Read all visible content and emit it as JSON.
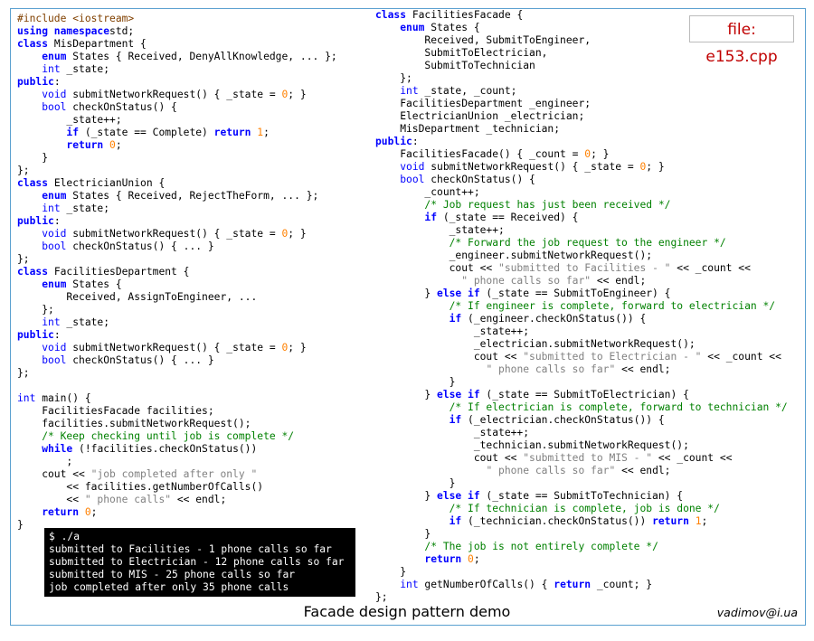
{
  "file_label": "file: e153.cpp",
  "caption": "Facade design pattern demo",
  "author": "vadimov@i.ua",
  "left_code": [
    [
      [
        "pp",
        "#include <iostream>"
      ]
    ],
    [
      [
        "kw",
        "using namespace"
      ],
      [
        "",
        "std;"
      ]
    ],
    [
      [
        "kw",
        "class"
      ],
      [
        "",
        " MisDepartment {"
      ]
    ],
    [
      [
        "",
        "    "
      ],
      [
        "kw",
        "enum"
      ],
      [
        "",
        " States { Received, DenyAllKnowledge, ... };"
      ]
    ],
    [
      [
        "",
        "    "
      ],
      [
        "kt",
        "int"
      ],
      [
        "",
        " _state;"
      ]
    ],
    [
      [
        "kw",
        "public"
      ],
      [
        "",
        ":"
      ]
    ],
    [
      [
        "",
        "    "
      ],
      [
        "kt",
        "void"
      ],
      [
        "",
        " submitNetworkRequest() { _state = "
      ],
      [
        "num",
        "0"
      ],
      [
        "",
        "; }"
      ]
    ],
    [
      [
        "",
        "    "
      ],
      [
        "kt",
        "bool"
      ],
      [
        "",
        " checkOnStatus() {"
      ]
    ],
    [
      [
        "",
        "        _state++;"
      ]
    ],
    [
      [
        "",
        "        "
      ],
      [
        "kw",
        "if"
      ],
      [
        "",
        " (_state == Complete) "
      ],
      [
        "kw",
        "return"
      ],
      [
        "",
        " "
      ],
      [
        "num",
        "1"
      ],
      [
        "",
        ";"
      ]
    ],
    [
      [
        "",
        "        "
      ],
      [
        "kw",
        "return"
      ],
      [
        "",
        " "
      ],
      [
        "num",
        "0"
      ],
      [
        "",
        ";"
      ]
    ],
    [
      [
        "",
        "    }"
      ]
    ],
    [
      [
        "",
        "};"
      ]
    ],
    [
      [
        "kw",
        "class"
      ],
      [
        "",
        " ElectricianUnion {"
      ]
    ],
    [
      [
        "",
        "    "
      ],
      [
        "kw",
        "enum"
      ],
      [
        "",
        " States { Received, RejectTheForm, ... };"
      ]
    ],
    [
      [
        "",
        "    "
      ],
      [
        "kt",
        "int"
      ],
      [
        "",
        " _state;"
      ]
    ],
    [
      [
        "kw",
        "public"
      ],
      [
        "",
        ":"
      ]
    ],
    [
      [
        "",
        "    "
      ],
      [
        "kt",
        "void"
      ],
      [
        "",
        " submitNetworkRequest() { _state = "
      ],
      [
        "num",
        "0"
      ],
      [
        "",
        "; }"
      ]
    ],
    [
      [
        "",
        "    "
      ],
      [
        "kt",
        "bool"
      ],
      [
        "",
        " checkOnStatus() { ... }"
      ]
    ],
    [
      [
        "",
        "};"
      ]
    ],
    [
      [
        "kw",
        "class"
      ],
      [
        "",
        " FacilitiesDepartment {"
      ]
    ],
    [
      [
        "",
        "    "
      ],
      [
        "kw",
        "enum"
      ],
      [
        "",
        " States {"
      ]
    ],
    [
      [
        "",
        "        Received, AssignToEngineer, ..."
      ]
    ],
    [
      [
        "",
        "    };"
      ]
    ],
    [
      [
        "",
        "    "
      ],
      [
        "kt",
        "int"
      ],
      [
        "",
        " _state;"
      ]
    ],
    [
      [
        "kw",
        "public"
      ],
      [
        "",
        ":"
      ]
    ],
    [
      [
        "",
        "    "
      ],
      [
        "kt",
        "void"
      ],
      [
        "",
        " submitNetworkRequest() { _state = "
      ],
      [
        "num",
        "0"
      ],
      [
        "",
        "; }"
      ]
    ],
    [
      [
        "",
        "    "
      ],
      [
        "kt",
        "bool"
      ],
      [
        "",
        " checkOnStatus() { ... }"
      ]
    ],
    [
      [
        "",
        "};"
      ]
    ],
    [
      [
        "",
        ""
      ]
    ],
    [
      [
        "kt",
        "int"
      ],
      [
        "",
        " main() {"
      ]
    ],
    [
      [
        "",
        "    FacilitiesFacade facilities;"
      ]
    ],
    [
      [
        "",
        "    facilities.submitNetworkRequest();"
      ]
    ],
    [
      [
        "",
        "    "
      ],
      [
        "cm",
        "/* Keep checking until job is complete */"
      ]
    ],
    [
      [
        "",
        "    "
      ],
      [
        "kw",
        "while"
      ],
      [
        "",
        " (!facilities.checkOnStatus())"
      ]
    ],
    [
      [
        "",
        "        ;"
      ]
    ],
    [
      [
        "",
        "    cout << "
      ],
      [
        "str",
        "\"job completed after only \""
      ]
    ],
    [
      [
        "",
        "        << facilities.getNumberOfCalls()"
      ]
    ],
    [
      [
        "",
        "        << "
      ],
      [
        "str",
        "\" phone calls\""
      ],
      [
        "",
        " << endl;"
      ]
    ],
    [
      [
        "",
        "    "
      ],
      [
        "kw",
        "return"
      ],
      [
        "",
        " "
      ],
      [
        "num",
        "0"
      ],
      [
        "",
        ";"
      ]
    ],
    [
      [
        "",
        "}"
      ]
    ]
  ],
  "right_code": [
    [
      [
        "kw",
        "class"
      ],
      [
        "",
        " FacilitiesFacade {"
      ]
    ],
    [
      [
        "",
        "    "
      ],
      [
        "kw",
        "enum"
      ],
      [
        "",
        " States {"
      ]
    ],
    [
      [
        "",
        "        Received, SubmitToEngineer,"
      ]
    ],
    [
      [
        "",
        "        SubmitToElectrician,"
      ]
    ],
    [
      [
        "",
        "        SubmitToTechnician"
      ]
    ],
    [
      [
        "",
        "    };"
      ]
    ],
    [
      [
        "",
        "    "
      ],
      [
        "kt",
        "int"
      ],
      [
        "",
        " _state, _count;"
      ]
    ],
    [
      [
        "",
        "    FacilitiesDepartment _engineer;"
      ]
    ],
    [
      [
        "",
        "    ElectricianUnion _electrician;"
      ]
    ],
    [
      [
        "",
        "    MisDepartment _technician;"
      ]
    ],
    [
      [
        "kw",
        "public"
      ],
      [
        "",
        ":"
      ]
    ],
    [
      [
        "",
        "    FacilitiesFacade() { _count = "
      ],
      [
        "num",
        "0"
      ],
      [
        "",
        "; }"
      ]
    ],
    [
      [
        "",
        "    "
      ],
      [
        "kt",
        "void"
      ],
      [
        "",
        " submitNetworkRequest() { _state = "
      ],
      [
        "num",
        "0"
      ],
      [
        "",
        "; }"
      ]
    ],
    [
      [
        "",
        "    "
      ],
      [
        "kt",
        "bool"
      ],
      [
        "",
        " checkOnStatus() {"
      ]
    ],
    [
      [
        "",
        "        _count++;"
      ]
    ],
    [
      [
        "",
        "        "
      ],
      [
        "cm",
        "/* Job request has just been received */"
      ]
    ],
    [
      [
        "",
        "        "
      ],
      [
        "kw",
        "if"
      ],
      [
        "",
        " (_state == Received) {"
      ]
    ],
    [
      [
        "",
        "            _state++;"
      ]
    ],
    [
      [
        "",
        "            "
      ],
      [
        "cm",
        "/* Forward the job request to the engineer */"
      ]
    ],
    [
      [
        "",
        "            _engineer.submitNetworkRequest();"
      ]
    ],
    [
      [
        "",
        "            cout << "
      ],
      [
        "str",
        "\"submitted to Facilities - \""
      ],
      [
        "",
        " << _count <<"
      ]
    ],
    [
      [
        "",
        "              "
      ],
      [
        "str",
        "\" phone calls so far\""
      ],
      [
        "",
        " << endl;"
      ]
    ],
    [
      [
        "",
        "        } "
      ],
      [
        "kw",
        "else if"
      ],
      [
        "",
        " (_state == SubmitToEngineer) {"
      ]
    ],
    [
      [
        "",
        "            "
      ],
      [
        "cm",
        "/* If engineer is complete, forward to electrician */"
      ]
    ],
    [
      [
        "",
        "            "
      ],
      [
        "kw",
        "if"
      ],
      [
        "",
        " (_engineer.checkOnStatus()) {"
      ]
    ],
    [
      [
        "",
        "                _state++;"
      ]
    ],
    [
      [
        "",
        "                _electrician.submitNetworkRequest();"
      ]
    ],
    [
      [
        "",
        "                cout << "
      ],
      [
        "str",
        "\"submitted to Electrician - \""
      ],
      [
        "",
        " << _count <<"
      ]
    ],
    [
      [
        "",
        "                  "
      ],
      [
        "str",
        "\" phone calls so far\""
      ],
      [
        "",
        " << endl;"
      ]
    ],
    [
      [
        "",
        "            }"
      ]
    ],
    [
      [
        "",
        "        } "
      ],
      [
        "kw",
        "else if"
      ],
      [
        "",
        " (_state == SubmitToElectrician) {"
      ]
    ],
    [
      [
        "",
        "            "
      ],
      [
        "cm",
        "/* If electrician is complete, forward to technician */"
      ]
    ],
    [
      [
        "",
        "            "
      ],
      [
        "kw",
        "if"
      ],
      [
        "",
        " (_electrician.checkOnStatus()) {"
      ]
    ],
    [
      [
        "",
        "                _state++;"
      ]
    ],
    [
      [
        "",
        "                _technician.submitNetworkRequest();"
      ]
    ],
    [
      [
        "",
        "                cout << "
      ],
      [
        "str",
        "\"submitted to MIS - \""
      ],
      [
        "",
        " << _count <<"
      ]
    ],
    [
      [
        "",
        "                  "
      ],
      [
        "str",
        "\" phone calls so far\""
      ],
      [
        "",
        " << endl;"
      ]
    ],
    [
      [
        "",
        "            }"
      ]
    ],
    [
      [
        "",
        "        } "
      ],
      [
        "kw",
        "else if"
      ],
      [
        "",
        " (_state == SubmitToTechnician) {"
      ]
    ],
    [
      [
        "",
        "            "
      ],
      [
        "cm",
        "/* If technician is complete, job is done */"
      ]
    ],
    [
      [
        "",
        "            "
      ],
      [
        "kw",
        "if"
      ],
      [
        "",
        " (_technician.checkOnStatus()) "
      ],
      [
        "kw",
        "return"
      ],
      [
        "",
        " "
      ],
      [
        "num",
        "1"
      ],
      [
        "",
        ";"
      ]
    ],
    [
      [
        "",
        "        }"
      ]
    ],
    [
      [
        "",
        "        "
      ],
      [
        "cm",
        "/* The job is not entirely complete */"
      ]
    ],
    [
      [
        "",
        "        "
      ],
      [
        "kw",
        "return"
      ],
      [
        "",
        " "
      ],
      [
        "num",
        "0"
      ],
      [
        "",
        ";"
      ]
    ],
    [
      [
        "",
        "    }"
      ]
    ],
    [
      [
        "",
        "    "
      ],
      [
        "kt",
        "int"
      ],
      [
        "",
        " getNumberOfCalls() { "
      ],
      [
        "kw",
        "return"
      ],
      [
        "",
        " _count; }"
      ]
    ],
    [
      [
        "",
        "};"
      ]
    ]
  ],
  "terminal": [
    "$ ./a",
    "submitted to Facilities - 1 phone calls so far",
    "submitted to Electrician - 12 phone calls so far",
    "submitted to MIS - 25 phone calls so far",
    "job completed after only 35 phone calls"
  ]
}
